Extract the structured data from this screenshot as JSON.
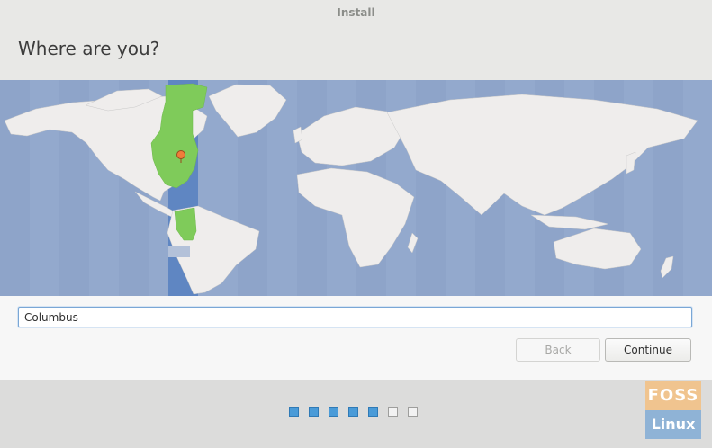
{
  "window": {
    "title": "Install"
  },
  "page": {
    "heading": "Where are you?"
  },
  "map": {
    "ocean_color": "#93a9cd",
    "land_color": "#efedec",
    "selected_zone_color": "#5f86c2",
    "highlight_color": "#7fcb5a",
    "pin_color": "#f07d3a"
  },
  "location": {
    "value": "Columbus"
  },
  "buttons": {
    "back": "Back",
    "continue": "Continue"
  },
  "progress": {
    "total_steps": 7,
    "completed_steps": 5,
    "accent_color": "#4a9bd8"
  },
  "watermark": {
    "top": "FOSS",
    "bottom": "Linux"
  }
}
